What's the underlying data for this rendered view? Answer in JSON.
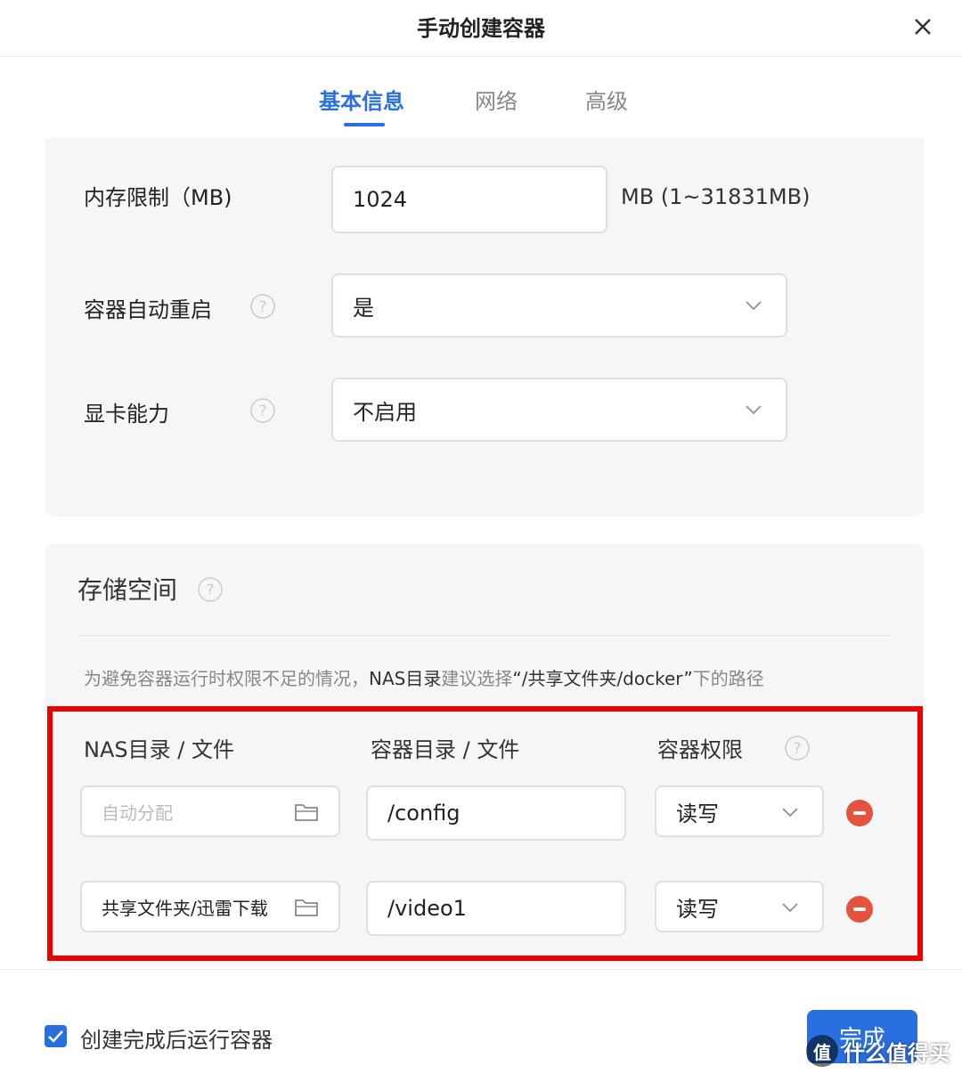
{
  "dialog": {
    "title": "手动创建容器"
  },
  "tabs": [
    {
      "label": "基本信息",
      "active": true
    },
    {
      "label": "网络",
      "active": false
    },
    {
      "label": "高级",
      "active": false
    }
  ],
  "basic": {
    "memory": {
      "label": "内存限制（MB)",
      "value": "1024",
      "unit": "MB (1~31831MB)"
    },
    "auto_restart": {
      "label": "容器自动重启",
      "value": "是"
    },
    "gpu": {
      "label": "显卡能力",
      "value": "不启用"
    }
  },
  "storage": {
    "title": "存储空间",
    "hint_prefix": "为避免容器运行时权限不足的情况，",
    "hint_nas": "NAS目录",
    "hint_middle": "建议选择",
    "hint_path": "“/共享文件夹/docker”",
    "hint_suffix": "下的路径",
    "columns": {
      "nas": "NAS目录 / 文件",
      "container": "容器目录 / 文件",
      "permission": "容器权限"
    },
    "rows": [
      {
        "nas_placeholder": "自动分配",
        "nas_value": "",
        "container_path": "/config",
        "permission": "读写"
      },
      {
        "nas_placeholder": "",
        "nas_value": "共享文件夹/迅雷下载",
        "container_path": "/video1",
        "permission": "读写"
      }
    ]
  },
  "footer": {
    "run_after_create_label": "创建完成后运行容器",
    "run_after_create_checked": true,
    "done_label": "完成"
  },
  "watermark": {
    "logo": "值",
    "text": "什么值得买"
  },
  "colors": {
    "accent": "#2a6fe0",
    "highlight_box": "#ee0000",
    "remove": "#e5533c"
  }
}
